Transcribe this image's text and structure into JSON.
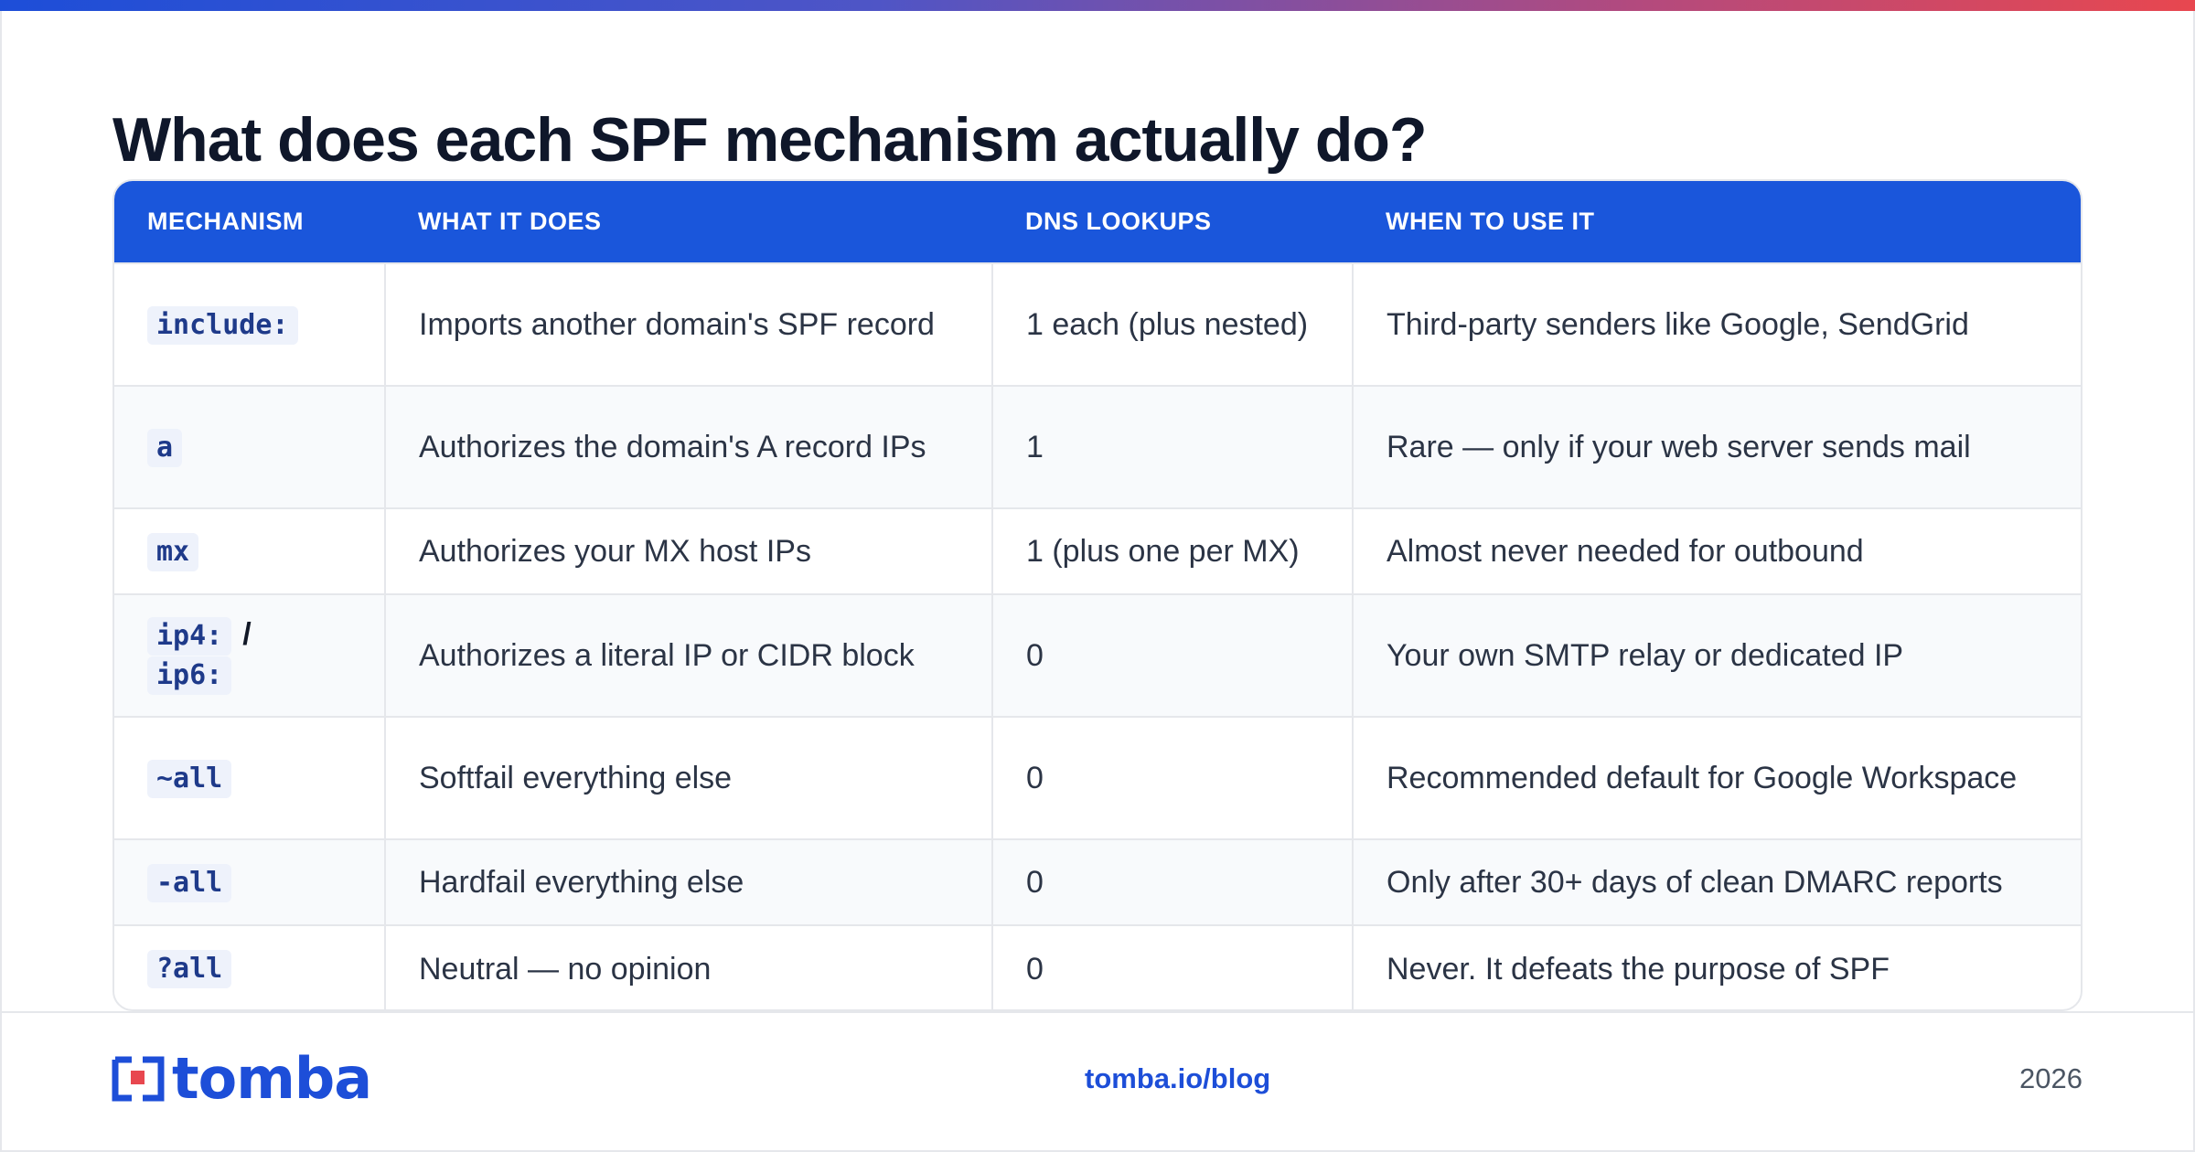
{
  "title": "What does each SPF mechanism actually do?",
  "table": {
    "headers": [
      "MECHANISM",
      "WHAT IT DOES",
      "DNS LOOKUPS",
      "WHEN TO USE IT"
    ],
    "rows": [
      {
        "mechanism": "include:",
        "does": "Imports another domain's SPF record",
        "lookups": "1 each (plus nested)",
        "when": "Third-party senders like Google, SendGrid"
      },
      {
        "mechanism": "a",
        "does": "Authorizes the domain's A record IPs",
        "lookups": "1",
        "when": "Rare — only if your web server sends mail"
      },
      {
        "mechanism": "mx",
        "does": "Authorizes your MX host IPs",
        "lookups": "1 (plus one per MX)",
        "when": "Almost never needed for outbound"
      },
      {
        "mechanism": "ip4:",
        "mechanism_separator": "/",
        "mechanism_2": "ip6:",
        "does": "Authorizes a literal IP or CIDR block",
        "lookups": "0",
        "when": "Your own SMTP relay or dedicated IP"
      },
      {
        "mechanism": "~all",
        "does": "Softfail everything else",
        "lookups": "0",
        "when": "Recommended default for Google Workspace"
      },
      {
        "mechanism": "-all",
        "does": "Hardfail everything else",
        "lookups": "0",
        "when": "Only after 30+ days of clean DMARC reports"
      },
      {
        "mechanism": "?all",
        "does": "Neutral — no opinion",
        "lookups": "0",
        "when": "Never. It defeats the purpose of SPF"
      }
    ]
  },
  "footer": {
    "logo_text": "tomba",
    "link": "tomba.io/blog",
    "year": "2026"
  },
  "colors": {
    "accent": "#1a56db",
    "logo_red": "#e8474f",
    "title": "#0f172a",
    "gradient": [
      "#1d4ed8",
      "#b44a7d",
      "#e8474f"
    ]
  },
  "icons": {
    "logo": "tomba-logo-icon"
  }
}
